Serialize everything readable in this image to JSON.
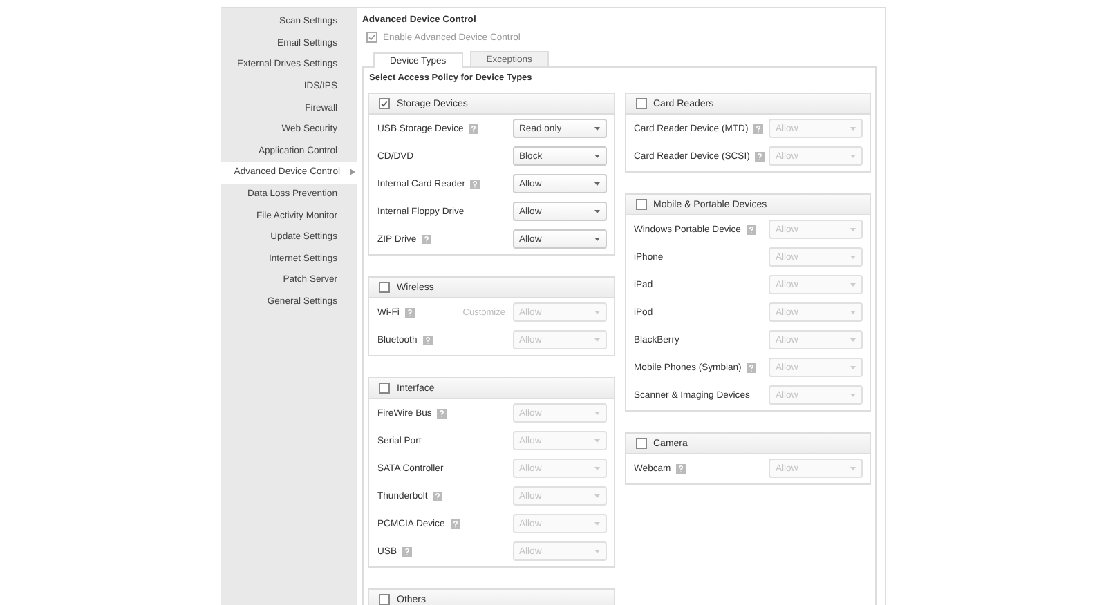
{
  "sidebar": {
    "items": [
      {
        "label": "Scan Settings",
        "selected": false
      },
      {
        "label": "Email Settings",
        "selected": false
      },
      {
        "label": "External Drives Settings",
        "selected": false
      },
      {
        "label": "IDS/IPS",
        "selected": false
      },
      {
        "label": "Firewall",
        "selected": false
      },
      {
        "label": "Web Security",
        "selected": false
      },
      {
        "label": "Application Control",
        "selected": false
      },
      {
        "label": "Advanced Device Control",
        "selected": true
      },
      {
        "label": "Data Loss Prevention",
        "selected": false
      },
      {
        "label": "File Activity Monitor",
        "selected": false
      },
      {
        "label": "Update Settings",
        "selected": false
      },
      {
        "label": "Internet Settings",
        "selected": false
      },
      {
        "label": "Patch Server",
        "selected": false
      },
      {
        "label": "General Settings",
        "selected": false
      }
    ]
  },
  "section_title": "Advanced Device Control",
  "enable_checkbox": {
    "label": "Enable Advanced Device Control",
    "checked": true
  },
  "tabs": [
    {
      "label": "Device Types",
      "selected": true
    },
    {
      "label": "Exceptions",
      "selected": false
    }
  ],
  "policy_heading": "Select Access Policy for Device Types",
  "columns": [
    [
      {
        "title": "Storage Devices",
        "checked": true,
        "rows": [
          {
            "label": "USB Storage Device",
            "help": true,
            "select": {
              "value": "Read only",
              "disabled": false
            }
          },
          {
            "label": "CD/DVD",
            "help": false,
            "select": {
              "value": "Block",
              "disabled": false
            }
          },
          {
            "label": "Internal Card Reader",
            "help": true,
            "select": {
              "value": "Allow",
              "disabled": false
            }
          },
          {
            "label": "Internal Floppy Drive",
            "help": false,
            "select": {
              "value": "Allow",
              "disabled": false
            }
          },
          {
            "label": "ZIP Drive",
            "help": true,
            "select": {
              "value": "Allow",
              "disabled": false
            }
          }
        ]
      },
      {
        "title": "Wireless",
        "checked": false,
        "rows": [
          {
            "label": "Wi-Fi",
            "help": true,
            "customize": "Customize",
            "select": {
              "value": "Allow",
              "disabled": true
            }
          },
          {
            "label": "Bluetooth",
            "help": true,
            "select": {
              "value": "Allow",
              "disabled": true
            }
          }
        ]
      },
      {
        "title": "Interface",
        "checked": false,
        "rows": [
          {
            "label": "FireWire Bus",
            "help": true,
            "select": {
              "value": "Allow",
              "disabled": true
            }
          },
          {
            "label": "Serial Port",
            "help": false,
            "select": {
              "value": "Allow",
              "disabled": true
            }
          },
          {
            "label": "SATA Controller",
            "help": false,
            "select": {
              "value": "Allow",
              "disabled": true
            }
          },
          {
            "label": "Thunderbolt",
            "help": true,
            "select": {
              "value": "Allow",
              "disabled": true
            }
          },
          {
            "label": "PCMCIA Device",
            "help": true,
            "select": {
              "value": "Allow",
              "disabled": true
            }
          },
          {
            "label": "USB",
            "help": true,
            "select": {
              "value": "Allow",
              "disabled": true
            }
          }
        ]
      },
      {
        "title": "Others",
        "checked": false
      }
    ],
    [
      {
        "title": "Card Readers",
        "checked": false,
        "rows": [
          {
            "label": "Card Reader Device (MTD)",
            "help": true,
            "select": {
              "value": "Allow",
              "disabled": true
            }
          },
          {
            "label": "Card Reader Device (SCSI)",
            "help": true,
            "select": {
              "value": "Allow",
              "disabled": true
            }
          }
        ]
      },
      {
        "title": "Mobile & Portable Devices",
        "checked": false,
        "rows": [
          {
            "label": "Windows Portable Device",
            "help": true,
            "select": {
              "value": "Allow",
              "disabled": true
            }
          },
          {
            "label": "iPhone",
            "help": false,
            "select": {
              "value": "Allow",
              "disabled": true
            }
          },
          {
            "label": "iPad",
            "help": false,
            "select": {
              "value": "Allow",
              "disabled": true
            }
          },
          {
            "label": "iPod",
            "help": false,
            "select": {
              "value": "Allow",
              "disabled": true
            }
          },
          {
            "label": "BlackBerry",
            "help": false,
            "select": {
              "value": "Allow",
              "disabled": true
            }
          },
          {
            "label": "Mobile Phones (Symbian)",
            "help": true,
            "select": {
              "value": "Allow",
              "disabled": true
            }
          },
          {
            "label": "Scanner & Imaging Devices",
            "help": false,
            "select": {
              "value": "Allow",
              "disabled": true
            }
          }
        ]
      },
      {
        "title": "Camera",
        "checked": false,
        "rows": [
          {
            "label": "Webcam",
            "help": true,
            "select": {
              "value": "Allow",
              "disabled": true
            }
          }
        ]
      }
    ]
  ]
}
